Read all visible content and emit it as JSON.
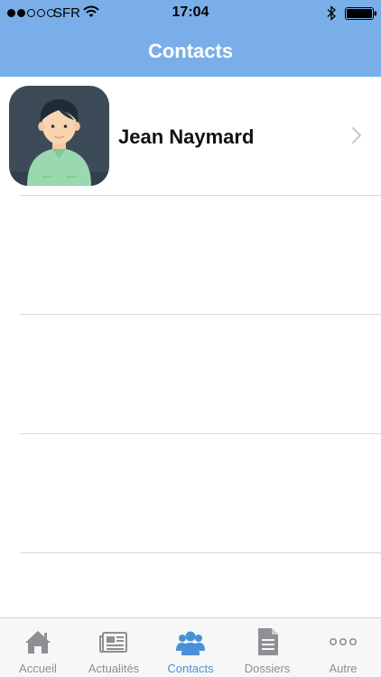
{
  "status_bar": {
    "carrier": "SFR",
    "time": "17:04",
    "signal_bars_filled": 2,
    "signal_bars_total": 5
  },
  "nav": {
    "title": "Contacts"
  },
  "contacts": [
    {
      "name": "Jean Naymard",
      "avatar_icon": "person-avatar-icon"
    },
    {
      "name": ""
    },
    {
      "name": ""
    },
    {
      "name": ""
    }
  ],
  "tabbar": {
    "active_tab": "contacts",
    "tabs": [
      {
        "id": "accueil",
        "label": "Accueil",
        "icon": "home-icon"
      },
      {
        "id": "actualites",
        "label": "Actualités",
        "icon": "newspaper-icon"
      },
      {
        "id": "contacts",
        "label": "Contacts",
        "icon": "people-icon"
      },
      {
        "id": "dossiers",
        "label": "Dossiers",
        "icon": "document-icon"
      },
      {
        "id": "autre",
        "label": "Autre",
        "icon": "more-icon"
      }
    ]
  },
  "colors": {
    "header_bg": "#7aaee8",
    "tab_active": "#4a90d9",
    "tab_inactive": "#8e8e93"
  }
}
